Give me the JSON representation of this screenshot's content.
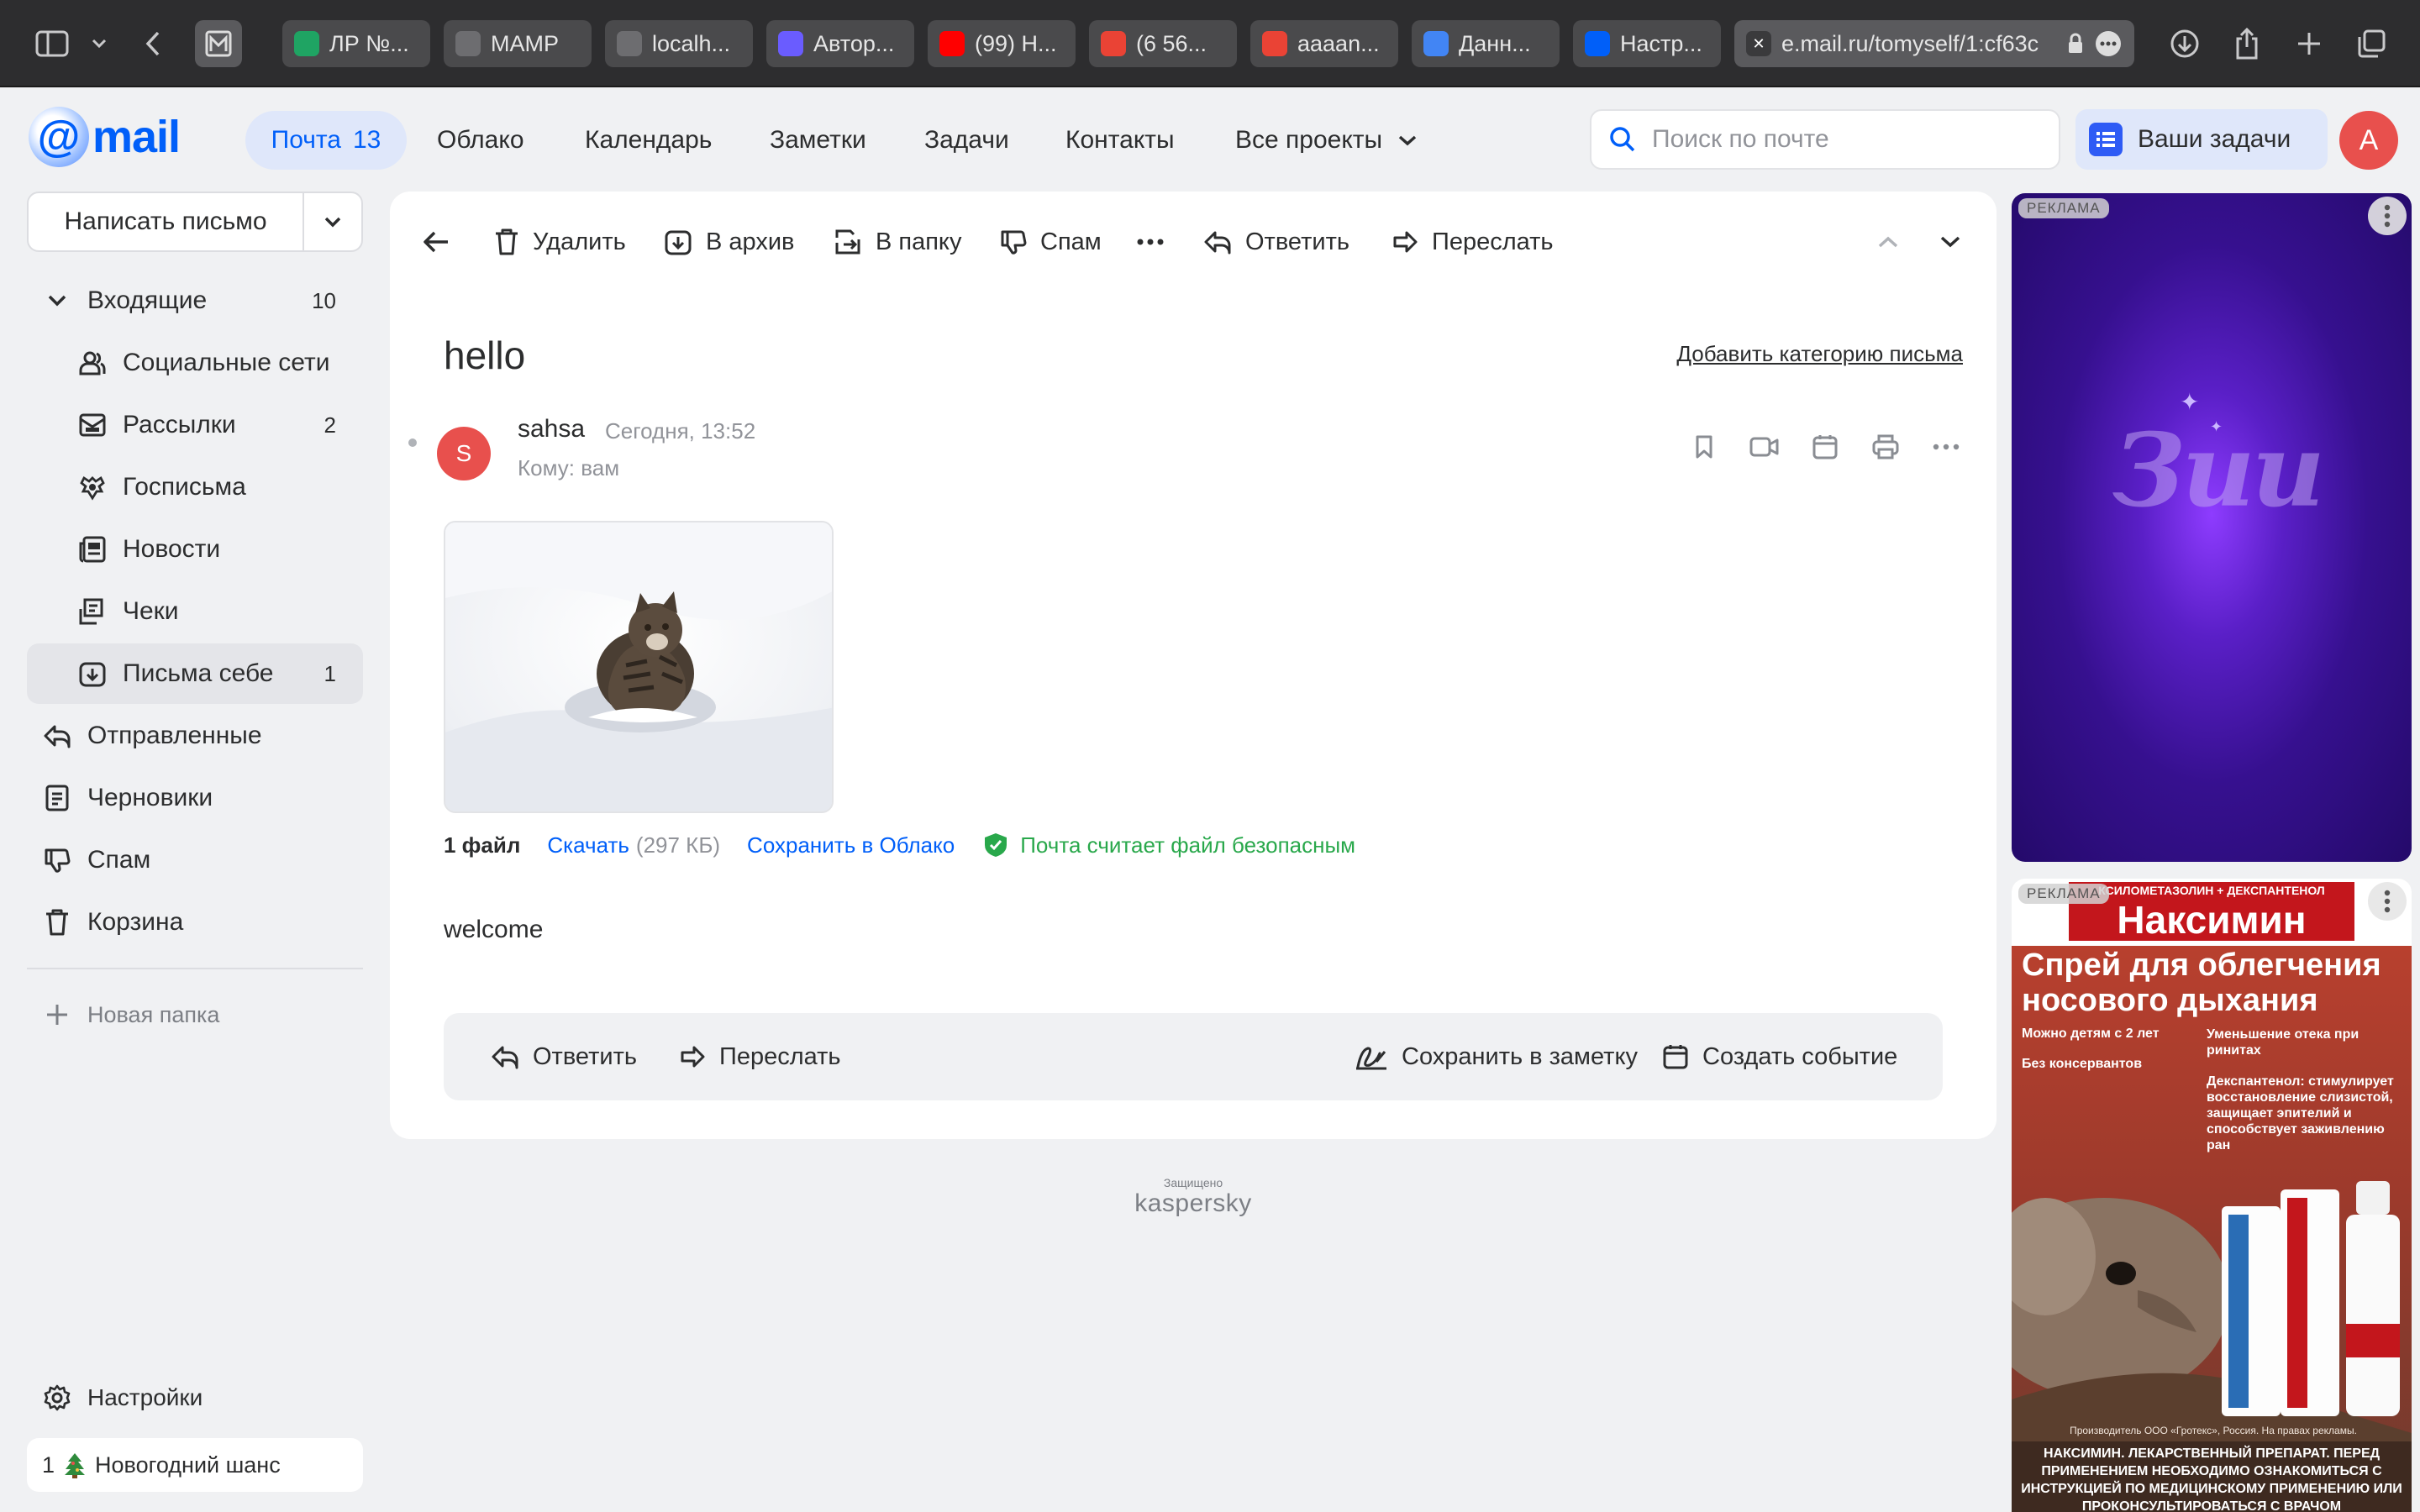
{
  "browser": {
    "tabs": [
      {
        "label": "ЛР №...",
        "fav": "slides-icon",
        "color": "#1fa463"
      },
      {
        "label": "MAMP",
        "fav": "elephant-icon",
        "color": "#6d6d70"
      },
      {
        "label": "localh...",
        "fav": "elephant-icon",
        "color": "#6d6d70"
      },
      {
        "label": "Автор...",
        "fav": "app-icon",
        "color": "#6a5cff"
      },
      {
        "label": "(99) Н...",
        "fav": "youtube-icon",
        "color": "#ff0000"
      },
      {
        "label": "(6 56...",
        "fav": "gmail-icon",
        "color": "#ea4335"
      },
      {
        "label": "aaaan...",
        "fav": "gmail-icon",
        "color": "#ea4335"
      },
      {
        "label": "Данн...",
        "fav": "google-icon",
        "color": "#4285f4"
      },
      {
        "label": "Настр...",
        "fav": "mailru-icon",
        "color": "#005ff9"
      }
    ],
    "url": "e.mail.ru/tomyself/1:cf63c"
  },
  "header": {
    "logo_text": "mail",
    "nav": {
      "mail": "Почта",
      "mail_count": "13",
      "cloud": "Облако",
      "calendar": "Календарь",
      "notes": "Заметки",
      "tasks": "Задачи",
      "contacts": "Контакты",
      "projects": "Все проекты"
    },
    "search_placeholder": "Поиск по почте",
    "tasks_button": "Ваши задачи",
    "avatar_letter": "А"
  },
  "sidebar": {
    "compose": "Написать письмо",
    "folders": [
      {
        "label": "Входящие",
        "count": "10"
      },
      {
        "label": "Социальные сети",
        "count": ""
      },
      {
        "label": "Рассылки",
        "count": "2"
      },
      {
        "label": "Госписьма",
        "count": ""
      },
      {
        "label": "Новости",
        "count": ""
      },
      {
        "label": "Чеки",
        "count": ""
      },
      {
        "label": "Письма себе",
        "count": "1"
      },
      {
        "label": "Отправленные",
        "count": ""
      },
      {
        "label": "Черновики",
        "count": ""
      },
      {
        "label": "Спам",
        "count": ""
      },
      {
        "label": "Корзина",
        "count": ""
      }
    ],
    "new_folder": "Новая папка",
    "settings": "Настройки",
    "promo": "Новогодний шанс",
    "promo_count": "1"
  },
  "toolbar": {
    "delete": "Удалить",
    "archive": "В архив",
    "move": "В папку",
    "spam": "Спам",
    "reply": "Ответить",
    "forward": "Переслать"
  },
  "message": {
    "subject": "hello",
    "add_category": "Добавить категорию письма",
    "sender_initial": "S",
    "sender": "sahsa",
    "date": "Сегодня, 13:52",
    "to": "Кому: вам",
    "attachments_count": "1 файл",
    "download": "Скачать",
    "download_size": "(297 КБ)",
    "save_cloud": "Сохранить в Облако",
    "safe_note": "Почта считает файл безопасным",
    "body": "welcome"
  },
  "reply_bar": {
    "reply": "Ответить",
    "forward": "Переслать",
    "save_note": "Сохранить в заметку",
    "create_event": "Создать событие"
  },
  "footer": {
    "protected": "Защищено",
    "brand": "kaspersky"
  },
  "ads": {
    "label": "РЕКЛАМА",
    "ad1_logo": "Зии",
    "ad2": {
      "top_strip": "КСИЛОМЕТАЗОЛИН + ДЕКСПАНТЕНОЛ",
      "brand": "Наксимин",
      "headline": "Спрей для облегчения носового дыхания",
      "bullet1": "Можно детям с 2 лет",
      "bullet2": "Без консервантов",
      "bullet3": "Уменьшение отека при ринитах",
      "bullet4": "Декспантенол: стимулирует восстановление слизистой, защищает эпителий и способствует заживлению ран",
      "maker": "Производитель ООО «Гротекс», Россия. На правах рекламы.",
      "disclaimer": "НАКСИМИН. ЛЕКАРСТВЕННЫЙ ПРЕПАРАТ. ПЕРЕД ПРИМЕНЕНИЕМ НЕОБХОДИМО ОЗНАКОМИТЬСЯ С ИНСТРУКЦИЕЙ ПО МЕДИЦИНСКОМУ ПРИМЕНЕНИЮ ИЛИ ПРОКОНСУЛЬТИРОВАТЬСЯ С ВРАЧОМ"
    }
  },
  "colors": {
    "accent": "#005ff9",
    "avatar": "#e8504d",
    "safe": "#29a84b"
  }
}
